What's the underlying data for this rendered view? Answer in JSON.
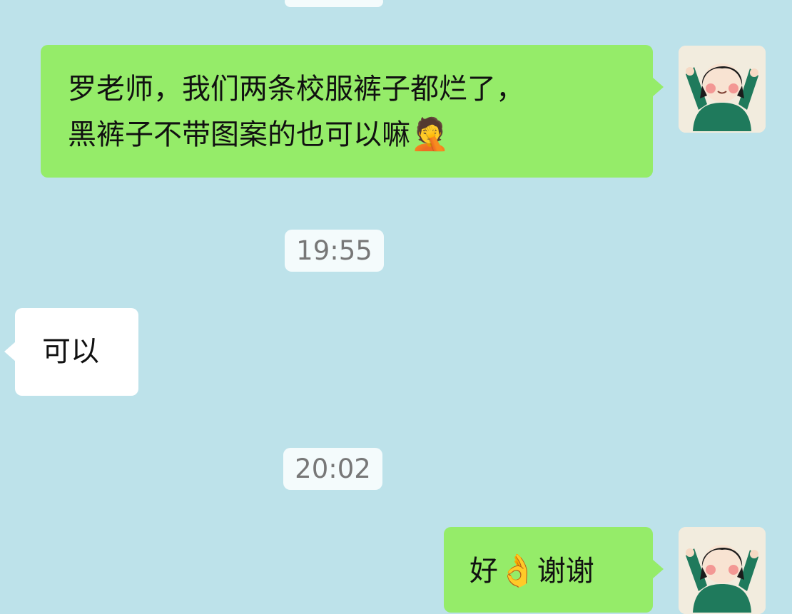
{
  "chat": {
    "messages": [
      {
        "direction": "outgoing",
        "text_line1": "罗老师，我们两条校服裤子都烂了，",
        "text_line2": "黑裤子不带图案的也可以嘛",
        "emoji": "🤦"
      },
      {
        "direction": "incoming",
        "text": "可以"
      },
      {
        "direction": "outgoing",
        "text_before": "好",
        "emoji": "👌",
        "text_after": "谢谢"
      }
    ],
    "timestamps": [
      "19:55",
      "20:02"
    ]
  },
  "colors": {
    "background": "#bde2ea",
    "outgoing_bubble": "#95ec69",
    "incoming_bubble": "#ffffff",
    "timestamp_bg": "#f4fbfc",
    "timestamp_text": "#777777"
  },
  "icons": {
    "facepalm": "face-palm-emoji",
    "ok_hand": "ok-hand-emoji",
    "avatar": "girl-in-green-sweater-avatar"
  }
}
